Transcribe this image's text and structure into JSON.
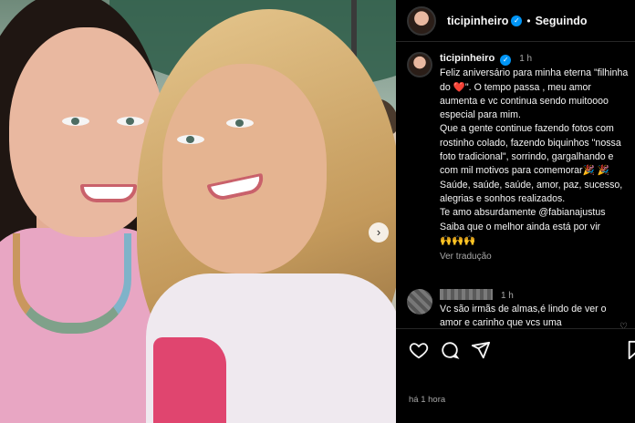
{
  "post": {
    "username": "ticipinheiro",
    "follow_state": "Seguindo",
    "caption_time": "1 h",
    "caption": "Feliz aniversário para minha eterna \"filhinha do ❤️\". O tempo passa , meu amor aumenta e vc continua sendo muitoooo especial para mim.\nQue a gente continue fazendo fotos com rostinho colado, fazendo biquinhos \"nossa foto tradicional\", sorrindo, gargalhando e com mil motivos para comemorar🎉 🎉 Saúde, saúde, saúde, amor, paz, sucesso, alegrias e sonhos realizados.\nTe amo absurdamente @fabianajustus\nSaiba que o melhor ainda está por vir\n🙌🙌🙌",
    "translate_label": "Ver tradução",
    "posted_ago": "há 1 hora"
  },
  "comment": {
    "time": "1 h",
    "text": "Vc são irmãs de almas,é lindo de ver o amor e carinho que vcs uma"
  },
  "icons": {
    "verified": "verified-badge-icon",
    "like": "heart-icon",
    "comment": "comment-icon",
    "share": "share-icon",
    "save": "bookmark-icon",
    "next": "chevron-right-icon"
  },
  "colors": {
    "background": "#000000",
    "verified": "#0095f6",
    "muted": "#a8a8a8"
  }
}
